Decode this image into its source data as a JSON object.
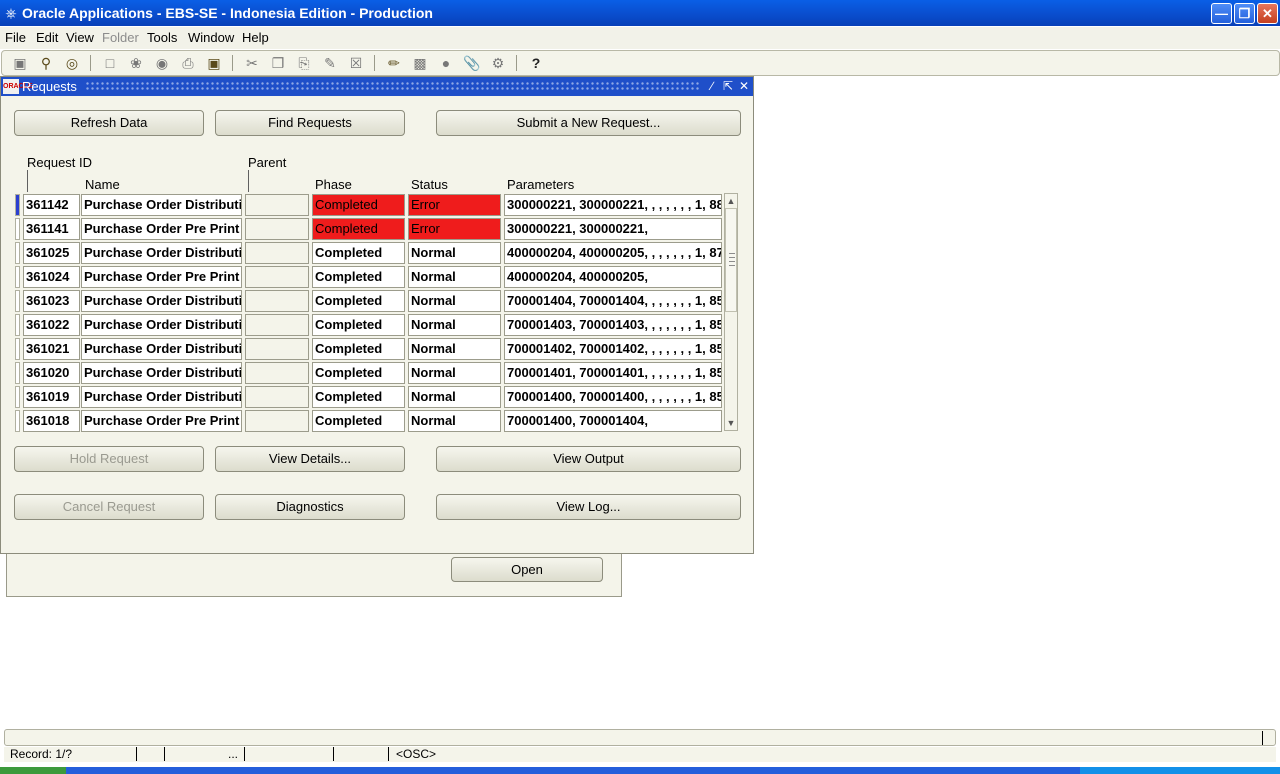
{
  "app": {
    "title": "Oracle Applications - EBS-SE - Indonesia Edition - Production",
    "menu": [
      "File",
      "Edit",
      "View",
      "Folder",
      "Tools",
      "Window",
      "Help"
    ]
  },
  "requests_window": {
    "title": "Requests",
    "buttons": {
      "refresh": "Refresh Data",
      "find": "Find Requests",
      "submit": "Submit a New Request...",
      "hold": "Hold Request",
      "view_details": "View Details...",
      "view_output": "View Output",
      "cancel": "Cancel Request",
      "diagnostics": "Diagnostics",
      "view_log": "View Log..."
    },
    "columns": {
      "request_id": "Request ID",
      "name": "Name",
      "parent": "Parent",
      "phase": "Phase",
      "status": "Status",
      "parameters": "Parameters"
    },
    "rows": [
      {
        "id": "361142",
        "name": "Purchase Order Distributi",
        "parent": "",
        "phase": "Completed",
        "status": "Error",
        "params": "300000221, 300000221, , , , , , , 1, 88"
      },
      {
        "id": "361141",
        "name": "Purchase Order Pre Print",
        "parent": "",
        "phase": "Completed",
        "status": "Error",
        "params": "300000221, 300000221,"
      },
      {
        "id": "361025",
        "name": "Purchase Order Distributi",
        "parent": "",
        "phase": "Completed",
        "status": "Normal",
        "params": "400000204, 400000205, , , , , , , 1, 87"
      },
      {
        "id": "361024",
        "name": "Purchase Order Pre Print",
        "parent": "",
        "phase": "Completed",
        "status": "Normal",
        "params": "400000204, 400000205,"
      },
      {
        "id": "361023",
        "name": "Purchase Order Distributi",
        "parent": "",
        "phase": "Completed",
        "status": "Normal",
        "params": "700001404, 700001404, , , , , , , 1, 85"
      },
      {
        "id": "361022",
        "name": "Purchase Order Distributi",
        "parent": "",
        "phase": "Completed",
        "status": "Normal",
        "params": "700001403, 700001403, , , , , , , 1, 85"
      },
      {
        "id": "361021",
        "name": "Purchase Order Distributi",
        "parent": "",
        "phase": "Completed",
        "status": "Normal",
        "params": "700001402, 700001402, , , , , , , 1, 85"
      },
      {
        "id": "361020",
        "name": "Purchase Order Distributi",
        "parent": "",
        "phase": "Completed",
        "status": "Normal",
        "params": "700001401, 700001401, , , , , , , 1, 85"
      },
      {
        "id": "361019",
        "name": "Purchase Order Distributi",
        "parent": "",
        "phase": "Completed",
        "status": "Normal",
        "params": "700001400, 700001400, , , , , , , 1, 85"
      },
      {
        "id": "361018",
        "name": "Purchase Order Pre Print",
        "parent": "",
        "phase": "Completed",
        "status": "Normal",
        "params": "700001400, 700001404,"
      }
    ]
  },
  "background_window": {
    "open_label": "Open"
  },
  "statusbar": {
    "record": "Record: 1/?",
    "ellipsis": "...",
    "osc": "<OSC>"
  },
  "colors": {
    "error_bg": "#ef1c1c",
    "title_blue": "#1f4fc9"
  }
}
